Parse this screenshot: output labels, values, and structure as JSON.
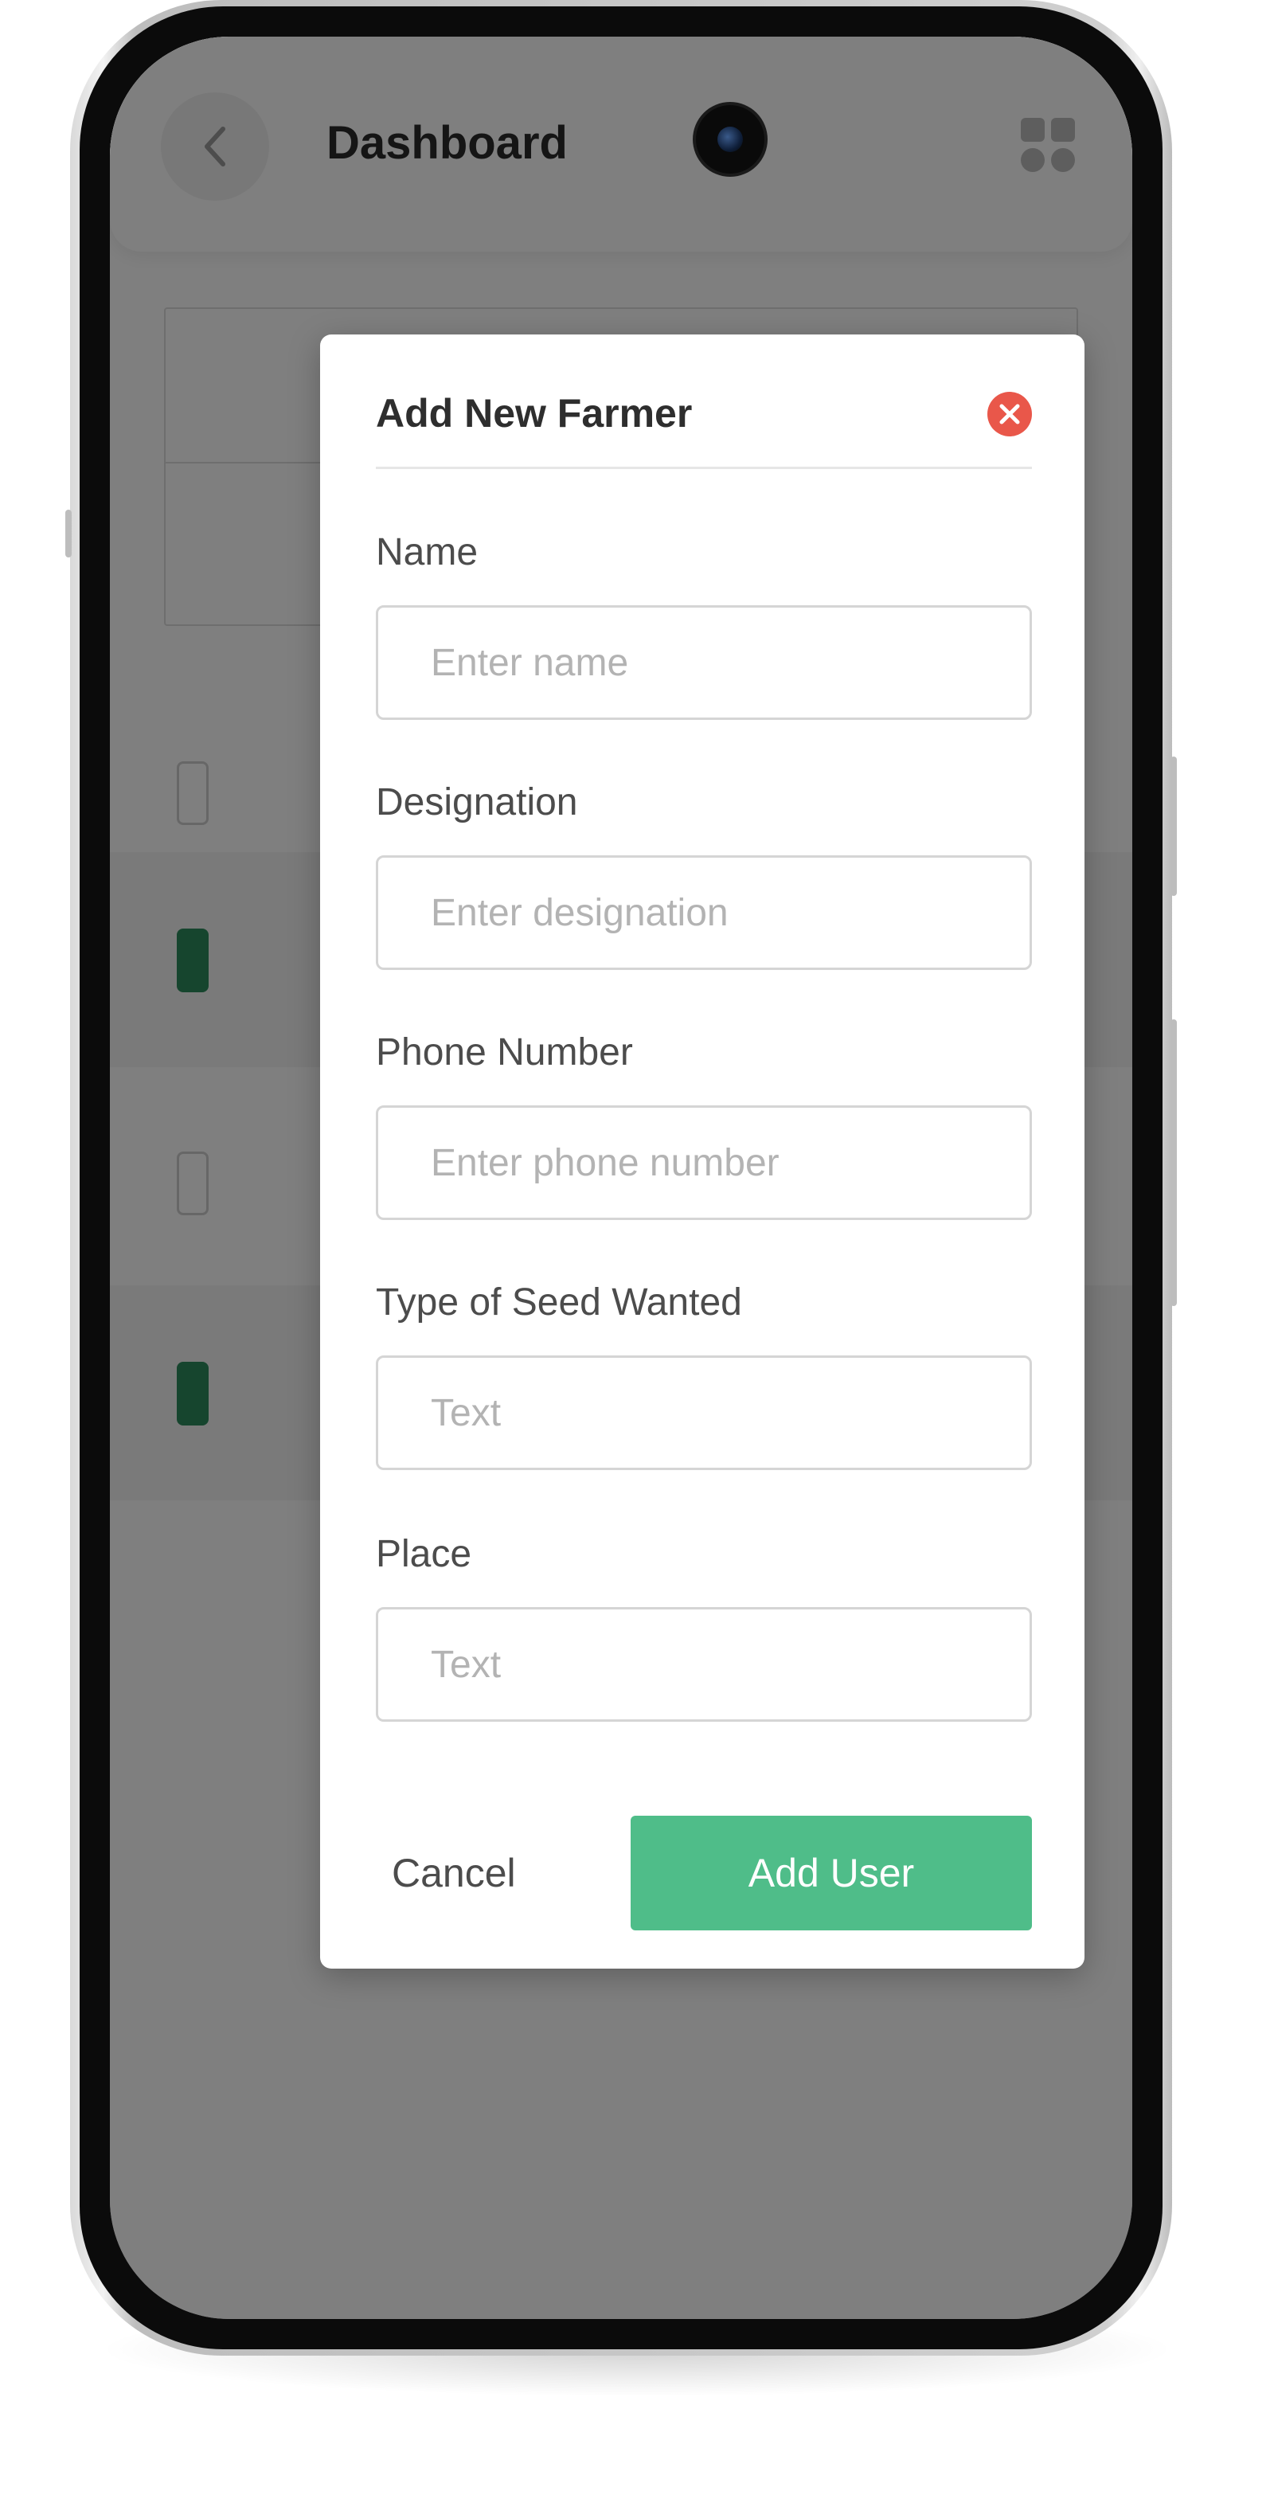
{
  "dashboard": {
    "title": "Dashboard"
  },
  "modal": {
    "title": "Add New Farmer",
    "fields": [
      {
        "label": "Name",
        "placeholder": "Enter name"
      },
      {
        "label": "Designation",
        "placeholder": "Enter designation"
      },
      {
        "label": "Phone Number",
        "placeholder": "Enter phone number"
      },
      {
        "label": "Type of Seed Wanted",
        "placeholder": "Text"
      },
      {
        "label": "Place",
        "placeholder": "Text"
      }
    ],
    "cancel_label": "Cancel",
    "submit_label": "Add User"
  },
  "icons": {
    "back": "chevron-left-icon",
    "grid": "grid-icon",
    "filter": "filter-icon",
    "close": "close-icon",
    "more": "more-horizontal-icon",
    "checkbox": "check-icon"
  },
  "colors": {
    "primary_green": "#4fbd89",
    "checkbox_green": "#2c8a5c",
    "close_red": "#e9574a",
    "accent_orange": "#f58e1f"
  }
}
